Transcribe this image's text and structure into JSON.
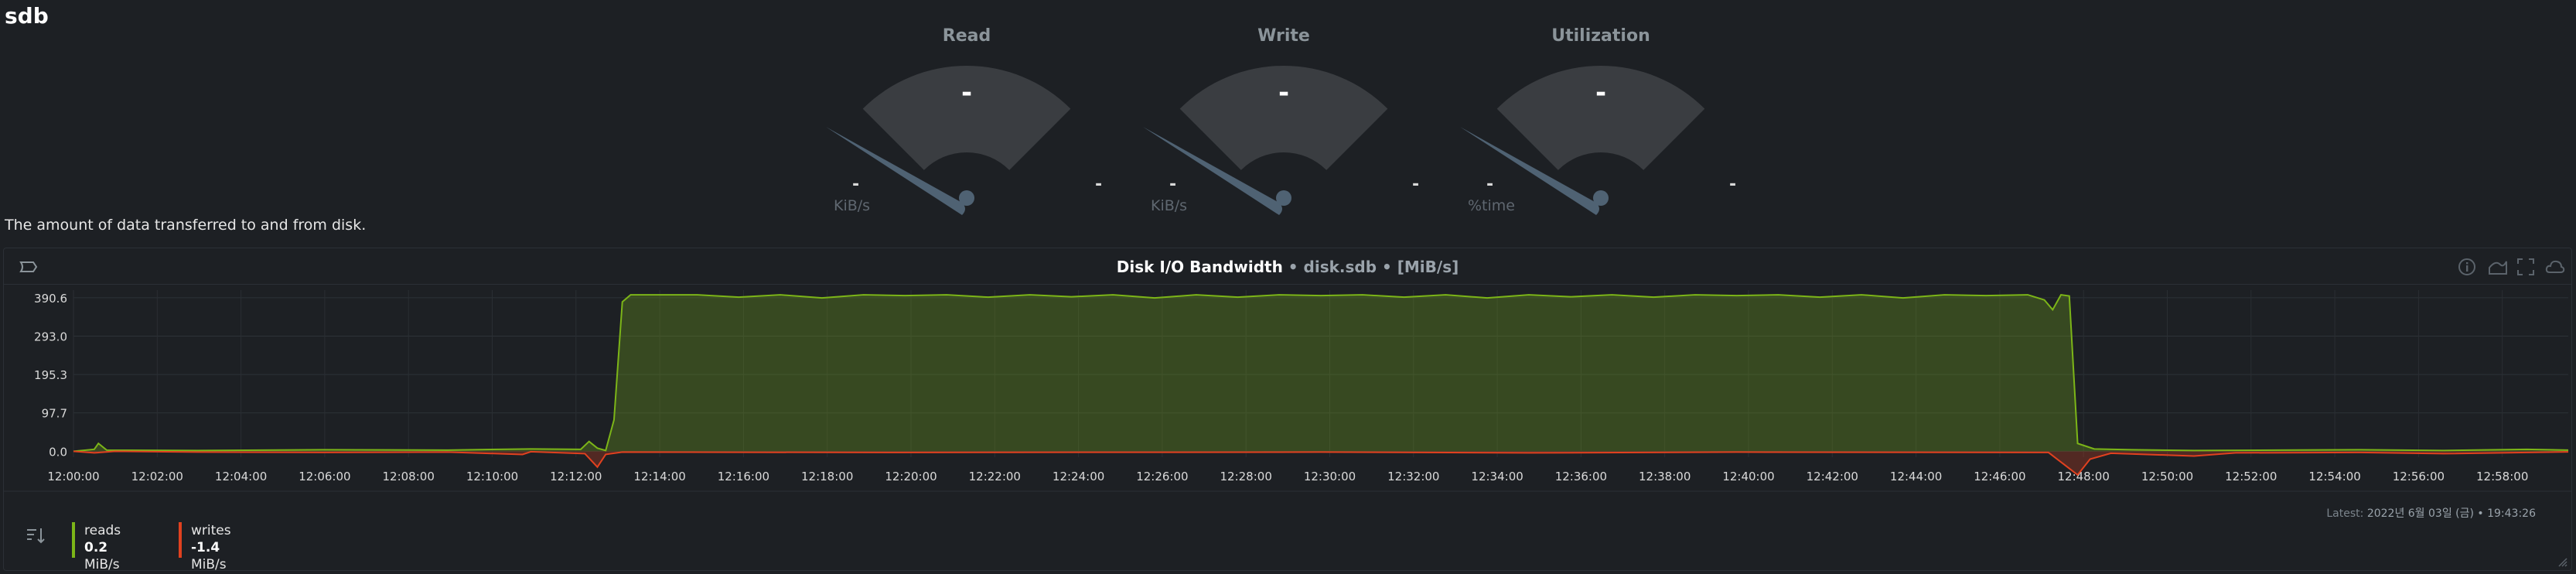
{
  "page": {
    "title": "sdb"
  },
  "gauges": [
    {
      "title": "Read",
      "value": "-",
      "min": "-",
      "max": "-",
      "unit": "KiB/s"
    },
    {
      "title": "Write",
      "value": "-",
      "min": "-",
      "max": "-",
      "unit": "KiB/s"
    },
    {
      "title": "Utilization",
      "value": "-",
      "min": "-",
      "max": "-",
      "unit": "%time"
    }
  ],
  "description": "The amount of data transferred to and from disk.",
  "panel": {
    "title": "Disk I/O Bandwidth",
    "context": " • disk.sdb • [MiB/s]",
    "latest_label": "Latest:",
    "latest_value": "2022년 6월 03일 (금) • 19:43:26",
    "icons": [
      "info-icon",
      "chart-type-icon",
      "fullscreen-icon",
      "cloud-icon"
    ]
  },
  "legend": [
    {
      "name": "reads",
      "value": "0.2",
      "unit": "MiB/s",
      "color": "#7cb518"
    },
    {
      "name": "writes",
      "value": "-1.4",
      "unit": "MiB/s",
      "color": "#e0411f"
    }
  ],
  "chart_data": {
    "type": "area",
    "title": "Disk I/O Bandwidth",
    "ylabel": "MiB/s",
    "ylim": [
      -15,
      410
    ],
    "y_ticks": [
      "390.6",
      "293.0",
      "195.3",
      "97.7",
      "0.0"
    ],
    "y_tick_values": [
      390.6,
      293.0,
      195.3,
      97.7,
      0.0
    ],
    "x_ticks": [
      "12:00:00",
      "12:02:00",
      "12:04:00",
      "12:06:00",
      "12:08:00",
      "12:10:00",
      "12:12:00",
      "12:14:00",
      "12:16:00",
      "12:18:00",
      "12:20:00",
      "12:22:00",
      "12:24:00",
      "12:26:00",
      "12:28:00",
      "12:30:00",
      "12:32:00",
      "12:34:00",
      "12:36:00",
      "12:38:00",
      "12:40:00",
      "12:42:00",
      "12:44:00",
      "12:46:00",
      "12:48:00",
      "12:50:00",
      "12:52:00",
      "12:54:00",
      "12:56:00",
      "12:58:00"
    ],
    "x_range_minutes": [
      0,
      60
    ],
    "series": [
      {
        "name": "reads",
        "color": "#7cb518",
        "points": [
          [
            0,
            0
          ],
          [
            0.5,
            5
          ],
          [
            0.6,
            20
          ],
          [
            0.8,
            3
          ],
          [
            3,
            2
          ],
          [
            6,
            4
          ],
          [
            9,
            3
          ],
          [
            11,
            6
          ],
          [
            12.2,
            5
          ],
          [
            12.4,
            25
          ],
          [
            12.6,
            8
          ],
          [
            12.8,
            2
          ],
          [
            13.0,
            80
          ],
          [
            13.2,
            380
          ],
          [
            13.4,
            398
          ],
          [
            15,
            398
          ],
          [
            16,
            392
          ],
          [
            17,
            398
          ],
          [
            18,
            390
          ],
          [
            19,
            398
          ],
          [
            20,
            396
          ],
          [
            21,
            398
          ],
          [
            22,
            392
          ],
          [
            23,
            398
          ],
          [
            24,
            393
          ],
          [
            25,
            398
          ],
          [
            26,
            390
          ],
          [
            27,
            398
          ],
          [
            28,
            392
          ],
          [
            29,
            398
          ],
          [
            30,
            396
          ],
          [
            31,
            398
          ],
          [
            32,
            392
          ],
          [
            33,
            398
          ],
          [
            34,
            390
          ],
          [
            35,
            398
          ],
          [
            36,
            393
          ],
          [
            37,
            398
          ],
          [
            38,
            392
          ],
          [
            39,
            398
          ],
          [
            40,
            396
          ],
          [
            41,
            398
          ],
          [
            42,
            392
          ],
          [
            43,
            398
          ],
          [
            44,
            390
          ],
          [
            45,
            398
          ],
          [
            46,
            396
          ],
          [
            47,
            398
          ],
          [
            47.4,
            385
          ],
          [
            47.6,
            360
          ],
          [
            47.8,
            398
          ],
          [
            48.0,
            395
          ],
          [
            48.2,
            20
          ],
          [
            48.6,
            6
          ],
          [
            49.5,
            4
          ],
          [
            51,
            2
          ],
          [
            53,
            3
          ],
          [
            55,
            4
          ],
          [
            57,
            2
          ],
          [
            59,
            5
          ],
          [
            60,
            3
          ]
        ]
      },
      {
        "name": "writes",
        "color": "#e0411f",
        "points": [
          [
            0,
            0
          ],
          [
            0.5,
            -4
          ],
          [
            1,
            0
          ],
          [
            3,
            -2
          ],
          [
            6,
            -3
          ],
          [
            9,
            -2
          ],
          [
            10.8,
            -8
          ],
          [
            11,
            -1
          ],
          [
            12.3,
            -6
          ],
          [
            12.6,
            -40
          ],
          [
            12.8,
            -8
          ],
          [
            13.2,
            -2
          ],
          [
            20,
            -3
          ],
          [
            30,
            -2
          ],
          [
            35,
            -4
          ],
          [
            40,
            -2
          ],
          [
            47.5,
            -3
          ],
          [
            48.2,
            -60
          ],
          [
            48.5,
            -20
          ],
          [
            49,
            -5
          ],
          [
            51,
            -12
          ],
          [
            52,
            -4
          ],
          [
            55,
            -3
          ],
          [
            57,
            -6
          ],
          [
            60,
            -1.4
          ]
        ]
      }
    ]
  }
}
